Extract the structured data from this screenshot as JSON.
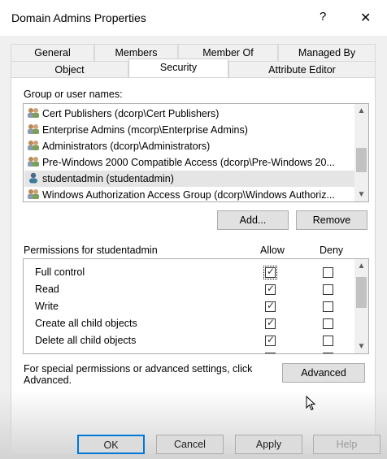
{
  "window": {
    "title": "Domain Admins Properties",
    "help_glyph": "?",
    "close_glyph": "✕"
  },
  "tabs_row1": [
    "General",
    "Members",
    "Member Of",
    "Managed By"
  ],
  "tabs_row2": [
    "Object",
    "Security",
    "Attribute Editor"
  ],
  "active_tab": "Security",
  "groups": {
    "label": "Group or user names:",
    "items": [
      {
        "label": "Cert Publishers (dcorp\\Cert Publishers)",
        "icon": "group-icon"
      },
      {
        "label": "Enterprise Admins (mcorp\\Enterprise Admins)",
        "icon": "group-icon"
      },
      {
        "label": "Administrators (dcorp\\Administrators)",
        "icon": "group-icon"
      },
      {
        "label": "Pre-Windows 2000 Compatible Access (dcorp\\Pre-Windows 20...",
        "icon": "group-icon"
      },
      {
        "label": "studentadmin (studentadmin)",
        "icon": "user-icon",
        "selected": true
      },
      {
        "label": "Windows Authorization Access Group (dcorp\\Windows Authoriz...",
        "icon": "group-icon"
      }
    ]
  },
  "buttons": {
    "add": "Add...",
    "remove": "Remove",
    "advanced": "Advanced",
    "ok": "OK",
    "cancel": "Cancel",
    "apply": "Apply",
    "help": "Help"
  },
  "permissions": {
    "label": "Permissions for studentadmin",
    "allow_header": "Allow",
    "deny_header": "Deny",
    "items": [
      {
        "label": "Full control",
        "allow": true,
        "deny": false
      },
      {
        "label": "Read",
        "allow": true,
        "deny": false
      },
      {
        "label": "Write",
        "allow": true,
        "deny": false
      },
      {
        "label": "Create all child objects",
        "allow": true,
        "deny": false
      },
      {
        "label": "Delete all child objects",
        "allow": true,
        "deny": false
      }
    ]
  },
  "advanced_note": "For special permissions or advanced settings, click Advanced.",
  "colors": {
    "accent": "#0078d7",
    "selection": "#e5e5e5"
  }
}
